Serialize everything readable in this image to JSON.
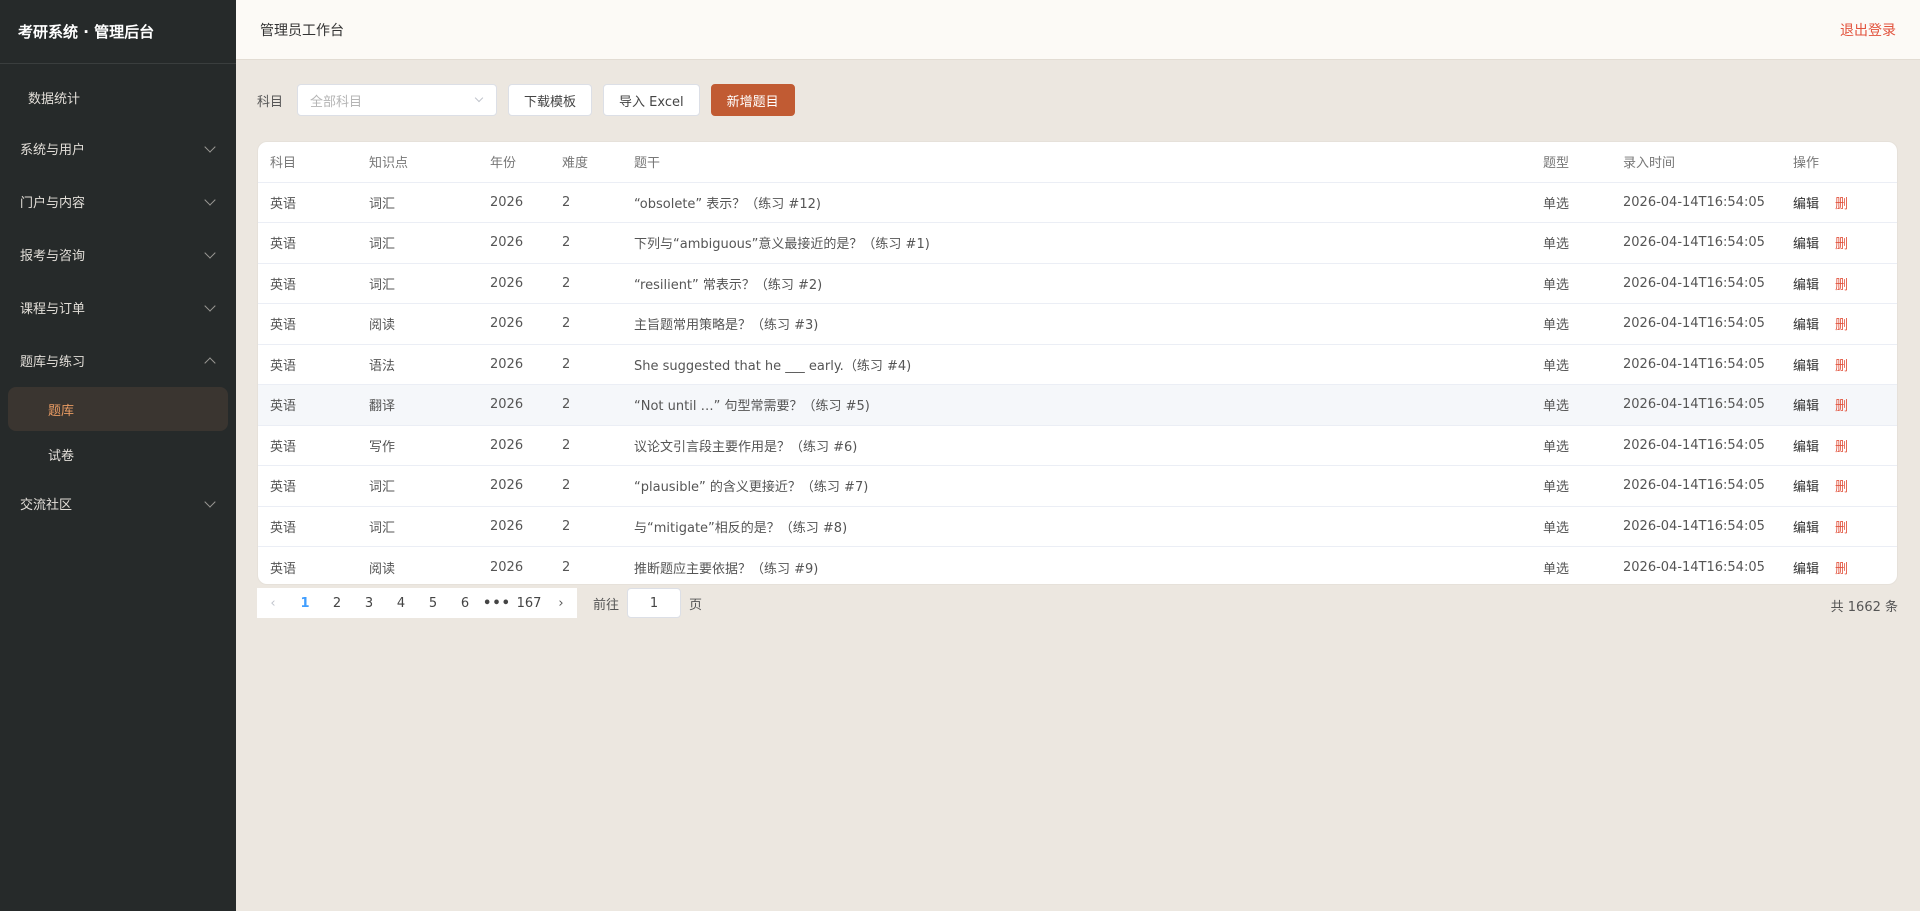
{
  "sidebar": {
    "brand": "考研系统 · 管理后台",
    "stats": "数据统计",
    "groups": [
      {
        "label": "系统与用户"
      },
      {
        "label": "门户与内容"
      },
      {
        "label": "报考与咨询"
      },
      {
        "label": "课程与订单"
      },
      {
        "label": "题库与练习"
      },
      {
        "label": "交流社区"
      }
    ],
    "sub_items": [
      {
        "label": "题库"
      },
      {
        "label": "试卷"
      }
    ]
  },
  "header": {
    "title": "管理员工作台",
    "logout": "退出登录"
  },
  "toolbar": {
    "subject_label": "科目",
    "subject_placeholder": "全部科目",
    "download_template": "下载模板",
    "import_excel": "导入 Excel",
    "add_question": "新增题目"
  },
  "table": {
    "columns": [
      "科目",
      "知识点",
      "年份",
      "难度",
      "题干",
      "题型",
      "录入时间",
      "操作"
    ],
    "edit_label": "编辑",
    "delete_label": "删",
    "rows": [
      {
        "subject": "英语",
        "point": "词汇",
        "year": "2026",
        "difficulty": "2",
        "stem": "“obsolete” 表示？（练习 #12)",
        "type": "单选",
        "time": "2026-04-14T16:54:05"
      },
      {
        "subject": "英语",
        "point": "词汇",
        "year": "2026",
        "difficulty": "2",
        "stem": "下列与“ambiguous”意义最接近的是？（练习 #1)",
        "type": "单选",
        "time": "2026-04-14T16:54:05"
      },
      {
        "subject": "英语",
        "point": "词汇",
        "year": "2026",
        "difficulty": "2",
        "stem": "“resilient” 常表示？（练习 #2)",
        "type": "单选",
        "time": "2026-04-14T16:54:05"
      },
      {
        "subject": "英语",
        "point": "阅读",
        "year": "2026",
        "difficulty": "2",
        "stem": "主旨题常用策略是？（练习 #3)",
        "type": "单选",
        "time": "2026-04-14T16:54:05"
      },
      {
        "subject": "英语",
        "point": "语法",
        "year": "2026",
        "difficulty": "2",
        "stem": "She suggested that he ___ early.（练习 #4)",
        "type": "单选",
        "time": "2026-04-14T16:54:05"
      },
      {
        "subject": "英语",
        "point": "翻译",
        "year": "2026",
        "difficulty": "2",
        "stem": "“Not until …” 句型常需要？（练习 #5)",
        "type": "单选",
        "time": "2026-04-14T16:54:05"
      },
      {
        "subject": "英语",
        "point": "写作",
        "year": "2026",
        "difficulty": "2",
        "stem": "议论文引言段主要作用是？（练习 #6)",
        "type": "单选",
        "time": "2026-04-14T16:54:05"
      },
      {
        "subject": "英语",
        "point": "词汇",
        "year": "2026",
        "difficulty": "2",
        "stem": "“plausible” 的含义更接近？（练习 #7)",
        "type": "单选",
        "time": "2026-04-14T16:54:05"
      },
      {
        "subject": "英语",
        "point": "词汇",
        "year": "2026",
        "difficulty": "2",
        "stem": "与“mitigate”相反的是？（练习 #8)",
        "type": "单选",
        "time": "2026-04-14T16:54:05"
      },
      {
        "subject": "英语",
        "point": "阅读",
        "year": "2026",
        "difficulty": "2",
        "stem": "推断题应主要依据？（练习 #9)",
        "type": "单选",
        "time": "2026-04-14T16:54:05"
      }
    ]
  },
  "pagination": {
    "prev": "‹",
    "next": "›",
    "pages": [
      "1",
      "2",
      "3",
      "4",
      "5",
      "6"
    ],
    "more": "•••",
    "last": "167",
    "current": "1",
    "goto_label": "前往",
    "goto_value": "1",
    "page_unit": "页",
    "total": "共 1662 条"
  }
}
